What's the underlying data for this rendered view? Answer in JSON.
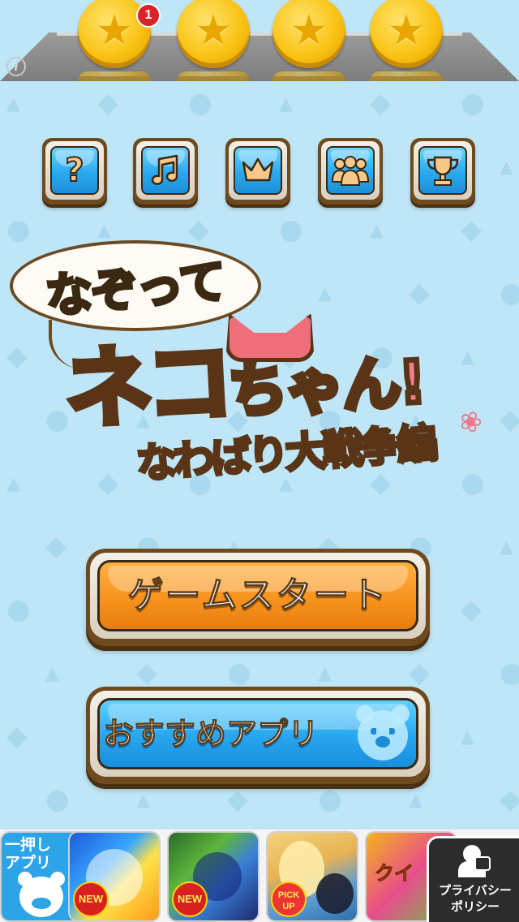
{
  "top_bar": {
    "notification_count": "1",
    "coins": [
      "coin-1",
      "coin-2",
      "coin-3",
      "coin-4"
    ],
    "info_icon": "i"
  },
  "menu_icons": [
    {
      "name": "help",
      "icon": "question-icon"
    },
    {
      "name": "sound",
      "icon": "music-note-icon"
    },
    {
      "name": "ranking",
      "icon": "crown-icon"
    },
    {
      "name": "friends",
      "icon": "people-icon"
    },
    {
      "name": "achievements",
      "icon": "trophy-icon"
    }
  ],
  "logo": {
    "line1": "なぞって",
    "line2_big": "ネコ",
    "line2_small": "ちゃん!",
    "line3": "なわばり大戦争編"
  },
  "buttons": {
    "start": "ゲームスタート",
    "recommended_apps": "おすすめアプリ"
  },
  "ad_strip": {
    "push_app_label": "一押し\nアプリ",
    "ad_tags": [
      "NEW",
      "NEW",
      "PICK UP",
      ""
    ],
    "quiz_text": "クイ",
    "privacy_label": "プライバシー\nポリシー"
  },
  "colors": {
    "background": "#bfe6f7",
    "start_button": "#f7931e",
    "apps_button": "#27a6ee",
    "icon_button": "#2aa9ef",
    "frame_brown": "#6e4a1f"
  }
}
